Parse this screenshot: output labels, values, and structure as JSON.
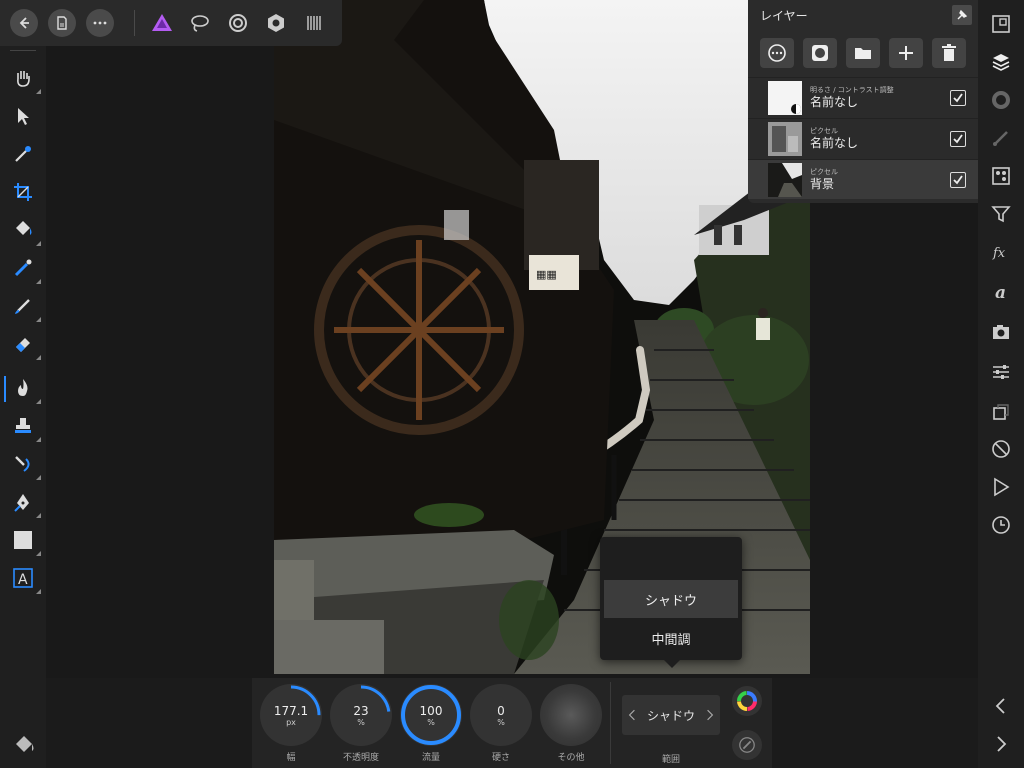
{
  "app": {
    "name": "Affinity Photo"
  },
  "topbar": {
    "buttons": [
      {
        "name": "back-button",
        "icon": "arrow-left-icon"
      },
      {
        "name": "document-button",
        "icon": "document-icon"
      },
      {
        "name": "more-button",
        "icon": "ellipsis-icon"
      }
    ],
    "personas": [
      {
        "name": "photo-persona",
        "icon": "affinity-photo-icon",
        "color": "#b45cf2"
      },
      {
        "name": "liquify-persona",
        "icon": "lasso-icon"
      },
      {
        "name": "develop-persona",
        "icon": "swirl-icon"
      },
      {
        "name": "tone-mapping-persona",
        "icon": "aperture-icon"
      },
      {
        "name": "export-persona",
        "icon": "barcode-icon"
      }
    ]
  },
  "layers_panel": {
    "title": "レイヤー",
    "actions": [
      "more-icon",
      "mask-icon",
      "folder-icon",
      "add-icon",
      "delete-icon"
    ],
    "layers": [
      {
        "type": "明るさ / コントラスト調整",
        "name": "名前なし",
        "checked": true,
        "selected": false
      },
      {
        "type": "ピクセル",
        "name": "名前なし",
        "checked": true,
        "selected": false
      },
      {
        "type": "ピクセル",
        "name": "背景",
        "checked": true,
        "selected": true
      }
    ]
  },
  "context_bar": {
    "dials": [
      {
        "value": "177.1",
        "unit": "px",
        "label": "幅",
        "fraction": 0.25
      },
      {
        "value": "23",
        "unit": "%",
        "label": "不透明度",
        "fraction": 0.23
      },
      {
        "value": "100",
        "unit": "%",
        "label": "流量",
        "fraction": 1.0
      },
      {
        "value": "0",
        "unit": "%",
        "label": "硬さ",
        "fraction": 0
      },
      {
        "value": "",
        "unit": "",
        "label": "その他",
        "fraction": 0
      }
    ],
    "range": {
      "value": "シャドウ",
      "label": "範囲"
    }
  },
  "range_menu": {
    "items": [
      {
        "label": "",
        "selected": false
      },
      {
        "label": "シャドウ",
        "selected": true
      },
      {
        "label": "中間調",
        "selected": false
      }
    ]
  },
  "colors": {
    "accent": "#2a8bff",
    "panel": "#2b2b2b",
    "persona": "#b45cf2"
  }
}
